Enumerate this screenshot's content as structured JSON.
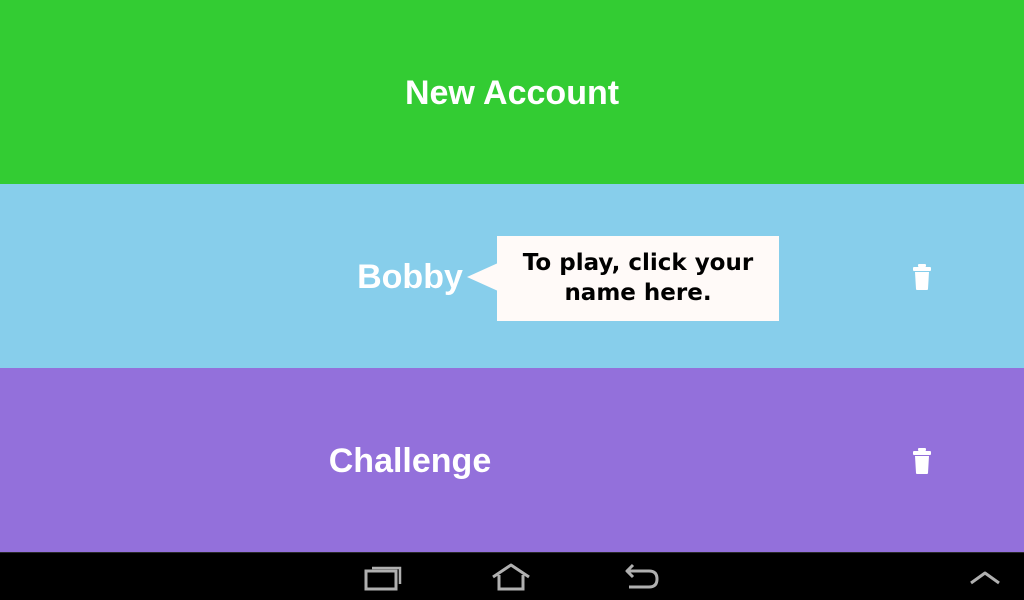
{
  "accounts": {
    "new_account_label": "New Account",
    "items": [
      {
        "name": "Bobby"
      },
      {
        "name": "Challenge"
      }
    ]
  },
  "tooltip": {
    "text": "To play, click your name here."
  },
  "colors": {
    "new_account_bg": "#33cc33",
    "bobby_bg": "#87ceeb",
    "challenge_bg": "#9370db",
    "label_text": "#ffffff",
    "tooltip_bg": "#fffaf8",
    "navbar_bg": "#000000"
  },
  "icons": {
    "delete": "trash-icon",
    "recent": "recent-apps-icon",
    "home": "home-icon",
    "back": "back-icon",
    "menu_up": "chevron-up-icon"
  }
}
